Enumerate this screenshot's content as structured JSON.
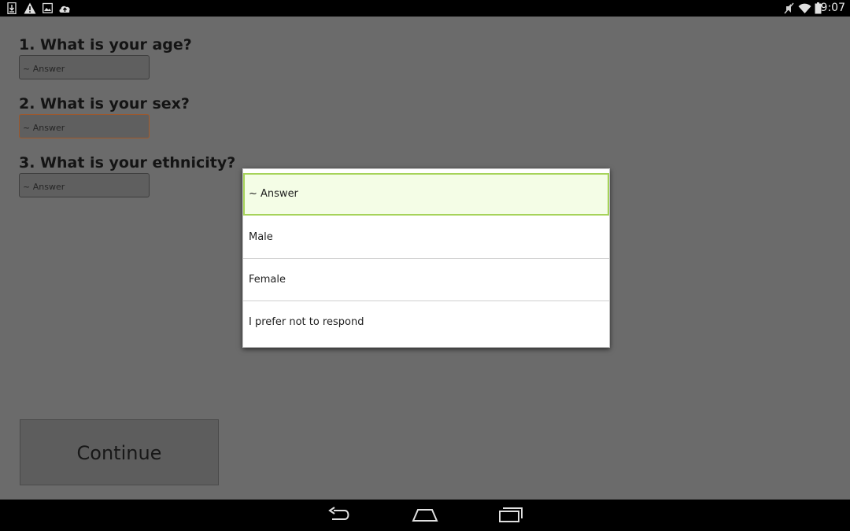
{
  "status_bar": {
    "time": "9:07",
    "left_icons": [
      "download-icon",
      "warning-icon",
      "image-icon",
      "cloud-upload-icon"
    ],
    "right_icons": [
      "mute-icon",
      "wifi-icon",
      "battery-icon"
    ]
  },
  "form": {
    "questions": [
      {
        "label": "1. What is your age?",
        "answer": "~ Answer"
      },
      {
        "label": "2. What is your sex?",
        "answer": "~ Answer"
      },
      {
        "label": "3. What is your ethnicity?",
        "answer": "~ Answer"
      }
    ],
    "continue_label": "Continue"
  },
  "dropdown": {
    "selected_index": 0,
    "options": [
      "~ Answer",
      "Male",
      "Female",
      "I prefer not to respond"
    ]
  },
  "colors": {
    "selected_option_bg": "#f4fde6",
    "selected_option_border": "#a6d35a",
    "focused_field_border": "#a0582a",
    "dim_background": "#6b6b6b"
  },
  "nav_bar": {
    "buttons": [
      "back-icon",
      "home-icon",
      "recents-icon"
    ]
  }
}
